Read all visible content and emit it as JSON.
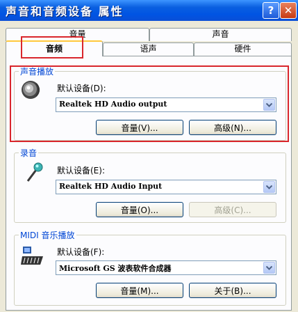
{
  "window": {
    "title": "声音和音频设备 属性",
    "help_label": "?",
    "close_label": "✕"
  },
  "tabs": {
    "row1": [
      "音量",
      "声音"
    ],
    "row2": [
      "音频",
      "语声",
      "硬件"
    ],
    "active": "音频"
  },
  "playback": {
    "group_label": "声音播放",
    "device_label": "默认设备(D):",
    "device_value": "Realtek HD Audio output",
    "volume_button": "音量(V)...",
    "advanced_button": "高级(N)...",
    "icon": "speaker-icon"
  },
  "recording": {
    "group_label": "录音",
    "device_label": "默认设备(E):",
    "device_value": "Realtek HD Audio Input",
    "volume_button": "音量(O)...",
    "advanced_button": "高级(C)...",
    "icon": "microphone-icon"
  },
  "midi": {
    "group_label": "MIDI 音乐播放",
    "device_label": "默认设备(F):",
    "device_value": "Microsoft GS 波表软件合成器",
    "volume_button": "音量(M)...",
    "about_button": "关于(B)...",
    "icon": "keyboard-icon"
  },
  "colors": {
    "titlebar": "#0054e3",
    "group_label": "#0046d5",
    "highlight": "#d9262c",
    "tab_accent": "#ffc83c"
  }
}
